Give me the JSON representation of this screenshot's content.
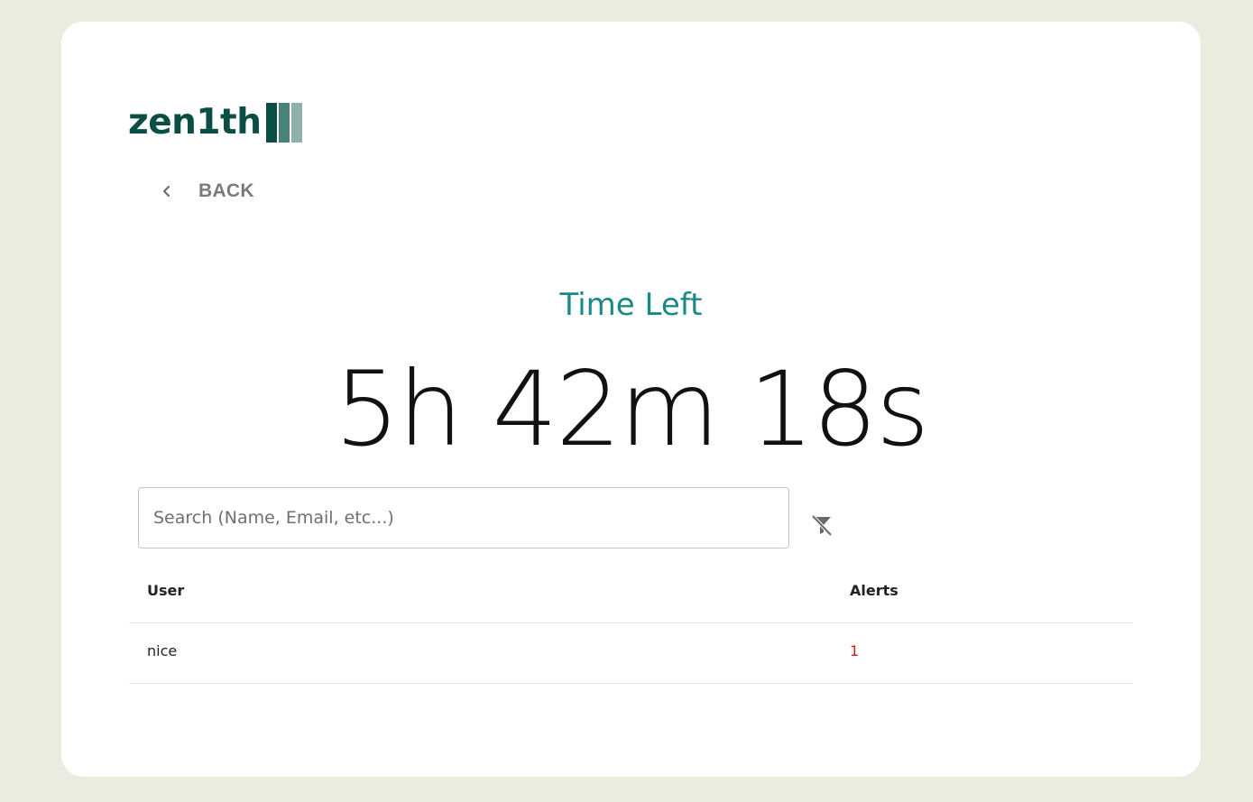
{
  "brand": {
    "logo_text": "zen1th",
    "colors": {
      "primary": "#0b4f44",
      "bar1": "#0b4f44",
      "bar2": "#4a8377",
      "bar3": "#8fb1a7"
    }
  },
  "nav": {
    "back_label": "BACK",
    "back_icon": "chevron-left-icon"
  },
  "timer": {
    "label": "Time Left",
    "value": "5h 42m 18s",
    "label_color": "#1a8a86"
  },
  "search": {
    "placeholder": "Search (Name, Email, etc...)",
    "value": "",
    "clear_filter_icon": "filter-off-icon"
  },
  "table": {
    "columns": [
      "User",
      "Alerts"
    ],
    "rows": [
      {
        "user": "nice",
        "alerts": "1"
      }
    ],
    "alert_color": "#d11a1a"
  }
}
